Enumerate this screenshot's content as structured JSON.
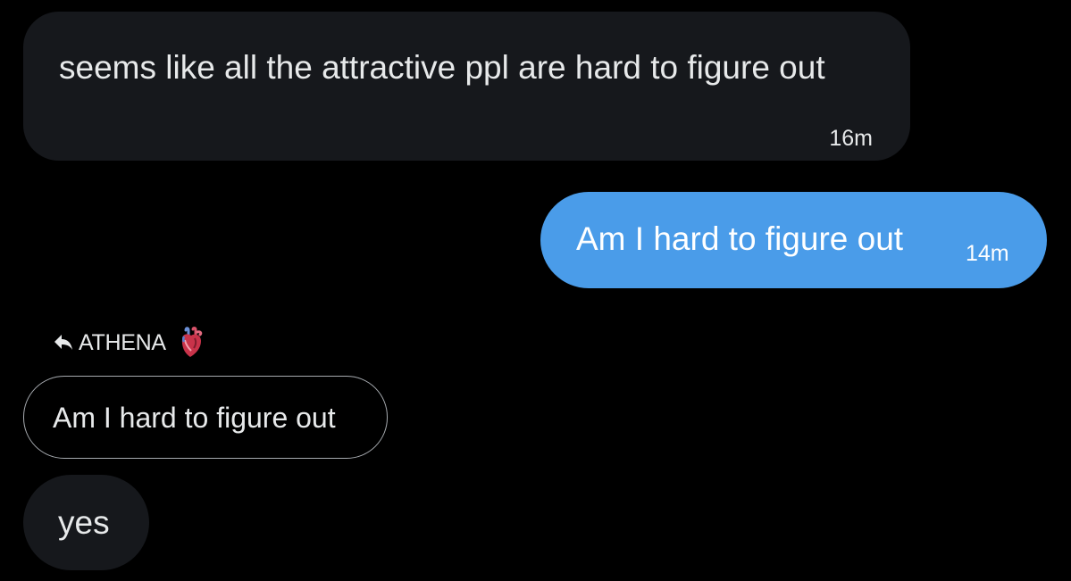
{
  "messages": {
    "incoming_1": {
      "text": "seems like all the attractive ppl are hard to figure out",
      "time": "16m"
    },
    "outgoing_1": {
      "text": "Am I hard to figure out",
      "time": "14m"
    },
    "reply": {
      "header": "ATHENA",
      "header_icons": [
        "reply-arrow-icon",
        "anatomical-heart-icon"
      ],
      "quoted_text": "Am I hard to figure out",
      "text": "yes"
    }
  },
  "colors": {
    "background": "#000000",
    "incoming_bubble": "#16181c",
    "outgoing_bubble": "#4a9ce9",
    "text": "#e7e9ea",
    "quoted_border": "#a7abb0"
  }
}
